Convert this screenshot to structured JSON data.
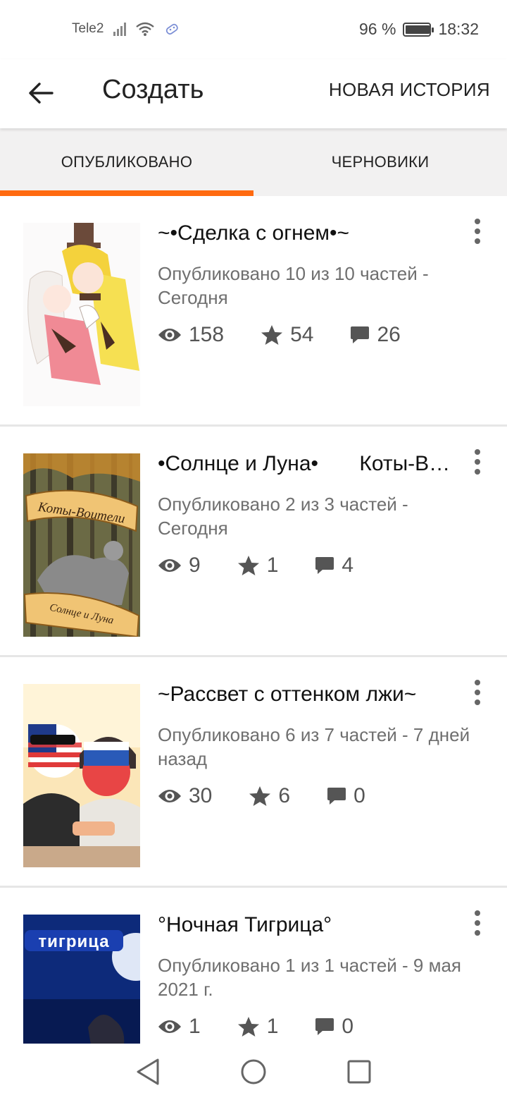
{
  "status_bar": {
    "carrier": "Tele2",
    "battery": "96 %",
    "battery_level": 0.96,
    "time": "18:32"
  },
  "app_bar": {
    "title": "Создать",
    "new_story_label": "НОВАЯ ИСТОРИЯ",
    "back_icon": "arrow-left-icon"
  },
  "tabs": [
    {
      "label": "ОПУБЛИКОВАНО",
      "active": true
    },
    {
      "label": "ЧЕРНОВИКИ",
      "active": false
    }
  ],
  "stories": [
    {
      "title": "~•Сделка с огнем•~",
      "meta": "Опубликовано 10 из 10 частей - Сегодня",
      "views": "158",
      "votes": "54",
      "comments": "26"
    },
    {
      "title": "•Солнце и Луна•       Коты-Воители",
      "meta": "Опубликовано 2 из 3 частей - Сегодня",
      "views": "9",
      "votes": "1",
      "comments": "4",
      "cover_text": [
        "Коты-Воители",
        "Солнце и Луна"
      ]
    },
    {
      "title": "~Рассвет с оттенком лжи~",
      "meta": "Опубликовано 6 из 7 частей - 7 дней назад",
      "views": "30",
      "votes": "6",
      "comments": "0"
    },
    {
      "title": "°Ночная Тигрица°",
      "meta": "Опубликовано 1 из 1 частей - 9 мая 2021 г.",
      "views": "1",
      "votes": "1",
      "comments": "0",
      "cover_text": [
        "тигрица"
      ]
    }
  ],
  "colors": {
    "accent": "#ff6a10",
    "tab_bg": "#f2f1f1",
    "meta_text": "#6f6f6f"
  },
  "icons": [
    "eye-icon",
    "star-icon",
    "comment-icon",
    "more-vert-icon",
    "nav-back-icon",
    "nav-home-icon",
    "nav-recents-icon",
    "wifi-icon",
    "signal-icon",
    "battery-icon"
  ]
}
